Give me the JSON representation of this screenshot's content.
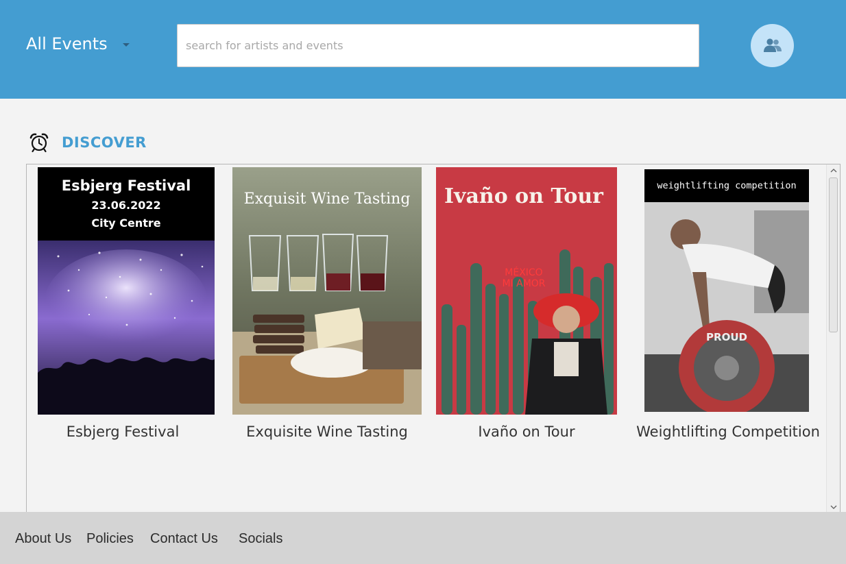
{
  "header": {
    "filter_label": "All Events",
    "search_placeholder": "search for artists and events",
    "profile_icon": "users-icon",
    "colors": {
      "background": "#449dd1",
      "profile_bg": "#c4e3f8"
    }
  },
  "discover": {
    "icon": "alarm-clock-icon",
    "title": "DISCOVER"
  },
  "events": [
    {
      "title": "Esbjerg Festival",
      "poster_title": "Esbjerg Festival",
      "poster_date": "23.06.2022",
      "poster_place": "City Centre"
    },
    {
      "title": "Exquisite Wine Tasting",
      "poster_title": "Exquisit Wine Tasting"
    },
    {
      "title": "Ivaño on Tour",
      "poster_title": "Ivaño on Tour",
      "poster_sign_line1": "MÉXICO",
      "poster_sign_line2": "MI AMOR"
    },
    {
      "title": "Weightlifting Competition",
      "poster_title": "weightlifting competition",
      "poster_plate_text": "PROUD"
    }
  ],
  "footer": {
    "links": [
      "About Us",
      "Policies",
      "Contact Us",
      "Socials"
    ]
  }
}
